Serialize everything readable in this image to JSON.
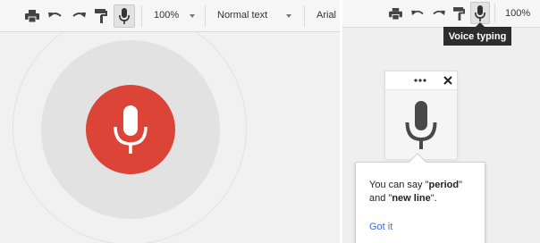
{
  "left": {
    "toolbar": {
      "zoom": "100%",
      "style": "Normal text",
      "font": "Arial",
      "icons": [
        "print-icon",
        "undo-icon",
        "redo-icon",
        "paint-format-icon",
        "microphone-icon"
      ]
    },
    "voice": {
      "mic_color": "#db4437",
      "state": "listening"
    }
  },
  "right": {
    "toolbar": {
      "zoom": "100%",
      "icons": [
        "print-icon",
        "undo-icon",
        "redo-icon",
        "paint-format-icon",
        "microphone-icon"
      ]
    },
    "tooltip": "Voice typing",
    "widget": {
      "icons": [
        "more-icon",
        "close-icon",
        "microphone-icon"
      ]
    },
    "help": {
      "line1_pre": "You can say \"",
      "line1_bold": "period",
      "line1_post": "\"",
      "line2_pre": "and \"",
      "line2_bold": "new line",
      "line2_post": "\".",
      "action": "Got it"
    }
  }
}
